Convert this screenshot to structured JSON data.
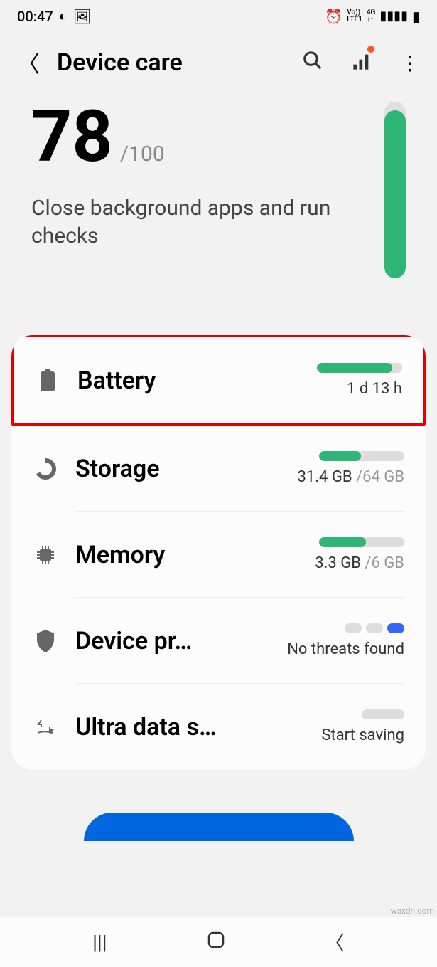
{
  "status": {
    "time": "00:47",
    "network": "4G",
    "lte": "LTE1",
    "vo": "Vo))"
  },
  "appBar": {
    "title": "Device care"
  },
  "score": {
    "value": "78",
    "max": "/100",
    "hint": "Close background apps and run checks",
    "fillPercent": 95
  },
  "items": {
    "battery": {
      "label": "Battery",
      "value": "1 d 13 h",
      "fillPercent": 88
    },
    "storage": {
      "label": "Storage",
      "used": "31.4 GB ",
      "total": "/64 GB",
      "fillPercent": 49
    },
    "memory": {
      "label": "Memory",
      "used": "3.3 GB ",
      "total": "/6 GB",
      "fillPercent": 55
    },
    "security": {
      "label": "Device pr…",
      "status": "No threats found"
    },
    "ultradata": {
      "label": "Ultra data s…",
      "status": "Start saving"
    }
  },
  "watermark": "wsxdn.com"
}
